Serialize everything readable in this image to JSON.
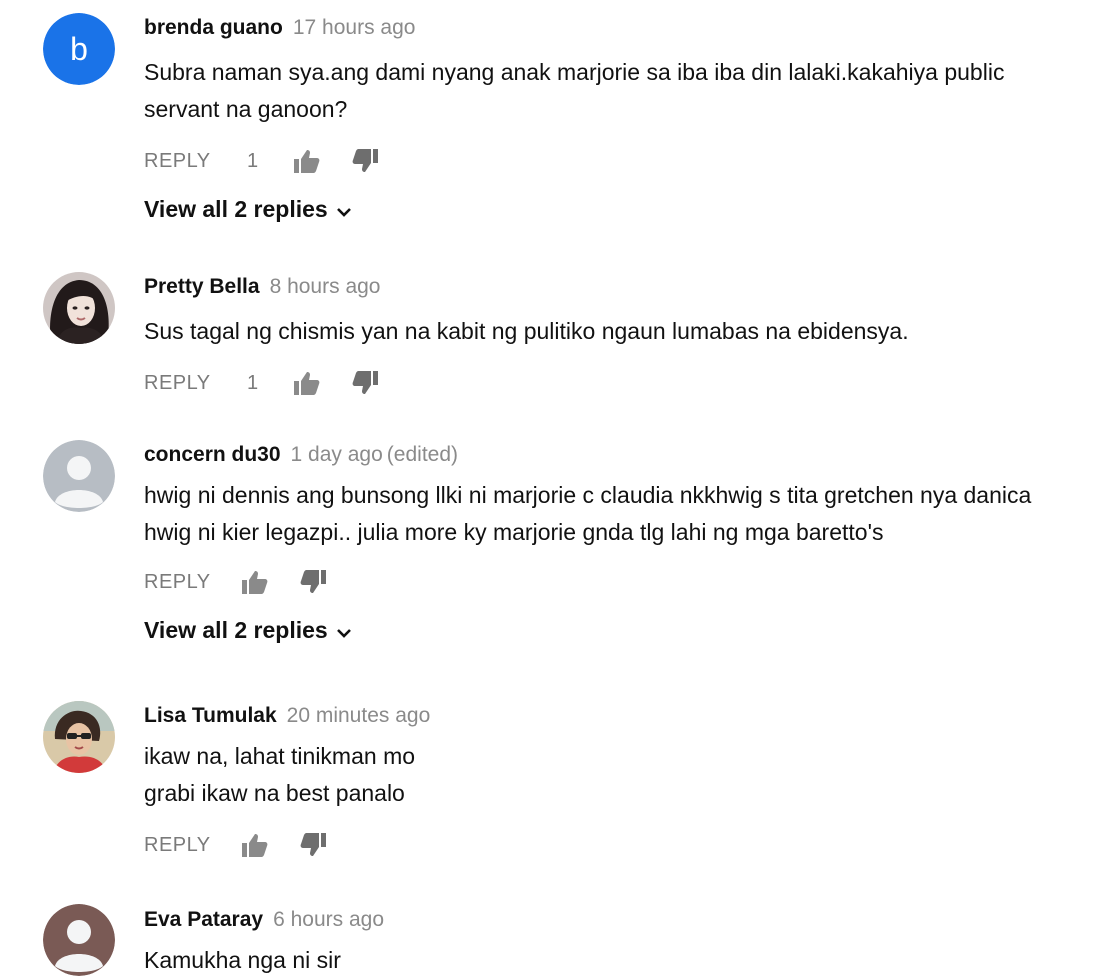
{
  "reply_label": "REPLY",
  "colors": {
    "author": "#111111",
    "meta": "#8a8a8a",
    "action": "#7a7a7a",
    "avatar_b_bg": "#1a73e8",
    "default_avatar_bg": "#b7bdc4",
    "default_avatar_fg": "#f4f5f6"
  },
  "comments": [
    {
      "author": "brenda guano",
      "time": "17 hours ago",
      "edited": "",
      "lines": [
        "Subra naman sya.ang dami nyang anak marjorie sa iba iba din lalaki.kakahiya public",
        "servant na ganoon?"
      ],
      "likes": "1",
      "avatar": "letter-b",
      "avatar_letter": "b",
      "view_replies": "View all 2 replies"
    },
    {
      "author": "Pretty Bella",
      "time": "8 hours ago",
      "edited": "",
      "lines": [
        "Sus tagal ng chismis yan na kabit ng pulitiko ngaun lumabas na ebidensya."
      ],
      "likes": "1",
      "avatar": "photo-woman-dark-hair",
      "view_replies": ""
    },
    {
      "author": "concern du30",
      "time": "1 day ago",
      "edited": "(edited)",
      "lines": [
        "hwig ni dennis ang bunsong llki ni marjorie c claudia nkkhwig s tita gretchen nya danica",
        "hwig ni kier legazpi.. julia more ky marjorie gnda tlg lahi ng mga baretto's"
      ],
      "likes": "",
      "avatar": "default-user",
      "view_replies": "View all 2 replies"
    },
    {
      "author": "Lisa Tumulak",
      "time": "20 minutes ago",
      "edited": "",
      "lines": [
        "ikaw na, lahat tinikman mo",
        "grabi ikaw na best panalo"
      ],
      "likes": "",
      "avatar": "photo-woman-sunglasses",
      "view_replies": ""
    },
    {
      "author": "Eva Pataray",
      "time": "6 hours ago",
      "edited": "",
      "lines": [
        "Kamukha nga ni sir"
      ],
      "likes": "",
      "avatar": "default-user-dark",
      "view_replies": ""
    }
  ]
}
